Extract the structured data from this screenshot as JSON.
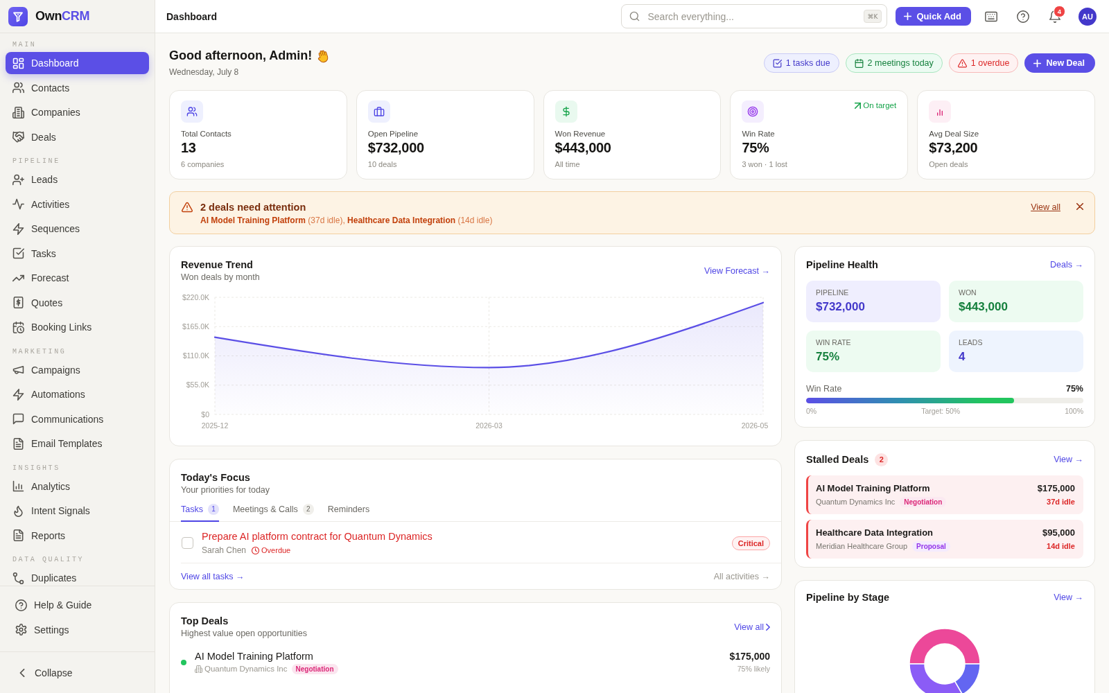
{
  "sidebar": {
    "brand": {
      "name": "Own",
      "accent": "CRM"
    },
    "sections": [
      {
        "label": "MAIN",
        "items": [
          {
            "label": "Dashboard",
            "selected": true
          },
          {
            "label": "Contacts",
            "selected": false
          },
          {
            "label": "Companies",
            "selected": false
          },
          {
            "label": "Deals",
            "selected": false
          }
        ]
      },
      {
        "label": "PIPELINE",
        "items": [
          {
            "label": "Leads",
            "selected": false
          },
          {
            "label": "Activities",
            "selected": false
          },
          {
            "label": "Sequences",
            "selected": false
          },
          {
            "label": "Tasks",
            "selected": false
          },
          {
            "label": "Forecast",
            "selected": false
          },
          {
            "label": "Quotes",
            "selected": false
          },
          {
            "label": "Booking Links",
            "selected": false
          }
        ]
      },
      {
        "label": "MARKETING",
        "items": [
          {
            "label": "Campaigns",
            "selected": false
          },
          {
            "label": "Automations",
            "selected": false
          },
          {
            "label": "Communications",
            "selected": false
          },
          {
            "label": "Email Templates",
            "selected": false
          }
        ]
      },
      {
        "label": "INSIGHTS",
        "items": [
          {
            "label": "Analytics",
            "selected": false
          },
          {
            "label": "Intent Signals",
            "selected": false
          },
          {
            "label": "Reports",
            "selected": false
          }
        ]
      },
      {
        "label": "DATA QUALITY",
        "items": [
          {
            "label": "Duplicates",
            "selected": false
          }
        ]
      }
    ],
    "footer_items": [
      {
        "label": "Help & Guide",
        "selected": false
      },
      {
        "label": "Settings",
        "selected": false
      }
    ],
    "collapse": "Collapse"
  },
  "topbar": {
    "title": "Dashboard",
    "search": {
      "placeholder": "Search everything...",
      "shortcut": "⌘K"
    },
    "quick_add": "Quick Add",
    "notifications": "4",
    "avatar": "AU"
  },
  "greeting": {
    "title": "Good afternoon, Admin!",
    "date": "Wednesday, July 8",
    "chips": [
      {
        "label": "1 tasks due",
        "kind": "tasks"
      },
      {
        "label": "2 meetings today",
        "kind": "meetings"
      },
      {
        "label": "1 overdue",
        "kind": "overdue"
      }
    ],
    "new_deal": "New Deal"
  },
  "stats": [
    {
      "kind": "contacts",
      "label": "Total Contacts",
      "value": "13",
      "note": "6 companies"
    },
    {
      "kind": "pipeline",
      "label": "Open Pipeline",
      "value": "$732,000",
      "note": "10 deals"
    },
    {
      "kind": "revenue",
      "label": "Won Revenue",
      "value": "$443,000",
      "note": "All time"
    },
    {
      "kind": "winrate",
      "label": "Win Rate",
      "value": "75%",
      "note": "3 won · 1 lost",
      "trend": "On target"
    },
    {
      "kind": "average",
      "label": "Avg Deal Size",
      "value": "$73,200",
      "note": "Open deals"
    }
  ],
  "alert": {
    "title": "2 deals need attention",
    "detail": "**AI Model Training Platform** (37d idle), **Healthcare Data Integration** (14d idle)",
    "link": "View all"
  },
  "revenue_trend": {
    "title": "Revenue Trend",
    "subtitle": "Won deals by month",
    "link": "View Forecast →",
    "chart_data": {
      "type": "area",
      "categories": [
        "2025-12",
        "2026-03",
        "2026-05"
      ],
      "series": [
        {
          "color": "#5b4fe6",
          "values": [
            145000,
            88000,
            210000
          ]
        }
      ],
      "ylim": [
        0,
        220000
      ],
      "yticks": [
        {
          "value": 0,
          "label": "$0"
        },
        {
          "value": 55000,
          "label": "$55.0K"
        },
        {
          "value": 110000,
          "label": "$110.0K"
        },
        {
          "value": 165000,
          "label": "$165.0K"
        },
        {
          "value": 220000,
          "label": "$220.0K"
        }
      ],
      "grid": true
    }
  },
  "todays_focus": {
    "title": "Today's Focus",
    "subtitle": "Your priorities for today",
    "tabs": [
      {
        "label": "Tasks",
        "count": "1",
        "selected": true
      },
      {
        "label": "Meetings & Calls",
        "count": "2",
        "selected": false
      },
      {
        "label": "Reminders",
        "selected": false
      }
    ],
    "tasks": [
      {
        "title": "Prepare AI platform contract for Quantum Dynamics",
        "assignee": "Sarah Chen",
        "status": "Overdue",
        "overdue": true,
        "priority": "Critical",
        "checked": false
      }
    ],
    "view_all": "View all tasks →",
    "all_activities": "All activities →"
  },
  "top_deals": {
    "title": "Top Deals",
    "subtitle": "Highest value open opportunities",
    "link": "View all",
    "deals": [
      {
        "name": "AI Model Training Platform",
        "company": "Quantum Dynamics Inc",
        "stage": {
          "label": "Negotiation",
          "color": "#db2777"
        },
        "amount": "$175,000",
        "likelihood": "75% likely",
        "color": "#22c55e"
      }
    ]
  },
  "pipeline_health": {
    "title": "Pipeline Health",
    "link": "Deals →",
    "tiles": [
      {
        "kind": "pipeline",
        "label": "PIPELINE",
        "value": "$732,000"
      },
      {
        "kind": "won",
        "label": "WON",
        "value": "$443,000"
      },
      {
        "kind": "winrate",
        "label": "WIN RATE",
        "value": "75%"
      },
      {
        "kind": "leads",
        "label": "LEADS",
        "value": "4"
      }
    ],
    "win_rate": {
      "label": "Win Rate",
      "reading": "75%",
      "level": 0.75,
      "min": "0%",
      "target": "Target: 50%",
      "max": "100%"
    }
  },
  "stalled_deals": {
    "title": "Stalled Deals",
    "count": "2",
    "link": "View →",
    "deals": [
      {
        "name": "AI Model Training Platform",
        "company": "Quantum Dynamics Inc",
        "stage": {
          "label": "Negotiation",
          "color": "#db2777"
        },
        "amount": "$175,000",
        "idle": "37d idle"
      },
      {
        "name": "Healthcare Data Integration",
        "company": "Meridian Healthcare Group",
        "stage": {
          "label": "Proposal",
          "color": "#9333ea"
        },
        "amount": "$95,000",
        "idle": "14d idle"
      }
    ]
  },
  "pipeline_by_stage": {
    "title": "Pipeline by Stage",
    "link": "View →"
  }
}
